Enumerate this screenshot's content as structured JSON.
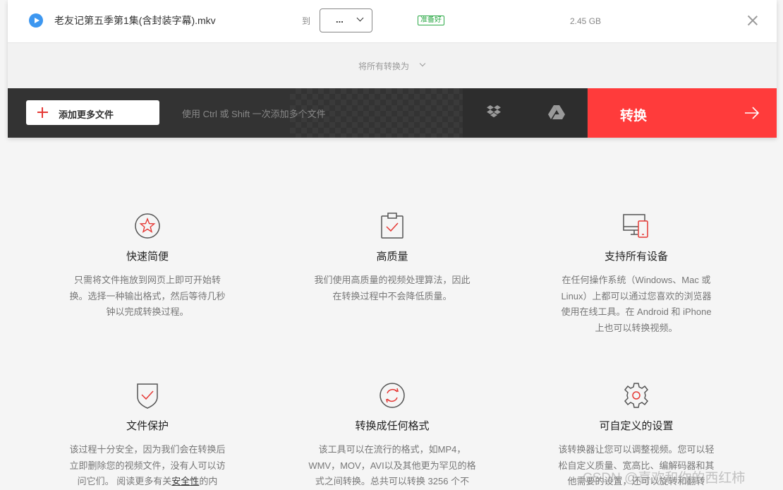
{
  "file": {
    "name": "老友记第五季第1集(含封装字幕).mkv",
    "to_label": "到",
    "format_value": "...",
    "status": "准备好",
    "size": "2.45 GB"
  },
  "convert_all": {
    "label": "将所有转换为"
  },
  "toolbar": {
    "add_files_label": "添加更多文件",
    "hint": "使用 Ctrl 或 Shift 一次添加多个文件",
    "convert_label": "转换"
  },
  "features": [
    {
      "icon": "star-icon",
      "title": "快速简便",
      "text": [
        "只需将文件拖放到网页上即可开始转",
        "换。选择一种输出格式，然后等待几秒",
        "钟以完成转换过程。"
      ]
    },
    {
      "icon": "clipboard-check-icon",
      "title": "高质量",
      "text": [
        "我们使用高质量的视频处理算法，因此",
        "在转换过程中不会降低质量。"
      ]
    },
    {
      "icon": "devices-icon",
      "title": "支持所有设备",
      "text": [
        "在任何操作系统（Windows、Mac 或",
        "Linux）上都可以通过您喜欢的浏览器",
        "使用在线工具。在 Android 和 iPhone",
        "上也可以转换视频。"
      ]
    },
    {
      "icon": "shield-check-icon",
      "title": "文件保护",
      "text_a": [
        "该过程十分安全，因为我们会在转换后",
        "立即删除您的视频文件，没有人可以访"
      ],
      "text_b_pre": "问它们。 阅读更多有关",
      "text_b_link": "安全性",
      "text_b_post": "的内"
    },
    {
      "icon": "refresh-icon",
      "title": "转换成任何格式",
      "text": [
        "该工具可以在流行的格式，如MP4，",
        "WMV，MOV，AVI以及其他更为罕见的格",
        "式之间转换。总共可以转换 3256 个不"
      ]
    },
    {
      "icon": "gear-icon",
      "title": "可自定义的设置",
      "text": [
        "该转换器让您可以调整视频。您可以轻",
        "松自定义质量、宽高比、编解码器和其",
        "他需要的设置，还可以旋转和翻转"
      ]
    }
  ],
  "watermark": "CSDN @喜欢和你的西红柿",
  "colors": {
    "accent": "#ff3b3b",
    "toolbar": "#333333",
    "ready": "#2aa845",
    "play": "#3d97f0"
  }
}
